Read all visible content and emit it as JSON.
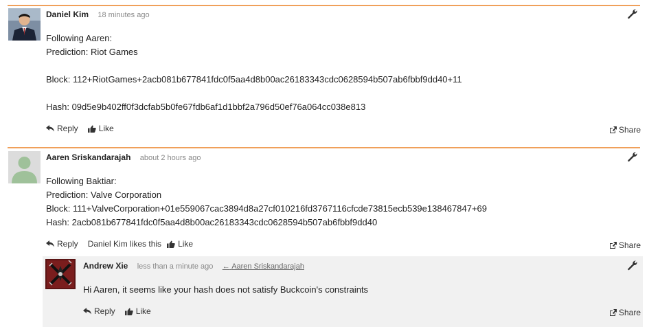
{
  "comments": [
    {
      "author": "Daniel Kim",
      "time": "18 minutes ago",
      "lines": [
        "Following Aaren:",
        "Prediction: Riot Games",
        "",
        "Block: 112+RiotGames+2acb081b677841fdc0f5aa4d8b00ac26183343cdc0628594b507ab6fbbf9dd40+11",
        "",
        "Hash: 09d5e9b402ff0f3dcfab5b0fe67fdb6af1d1bbf2a796d50ef76a064cc038e813"
      ],
      "reply": "Reply",
      "like": "Like",
      "share": "Share"
    },
    {
      "author": "Aaren Sriskandarajah",
      "time": "about 2 hours ago",
      "lines": [
        "Following Baktiar:",
        "Prediction: Valve Corporation",
        "Block: 111+ValveCorporation+01e559067cac3894d8a27cf010216fd3767116cfcde73815ecb539e138467847+69",
        "Hash: 2acb081b677841fdc0f5aa4d8b00ac26183343cdc0628594b507ab6fbbf9dd40"
      ],
      "reply": "Reply",
      "likes_text": "Daniel Kim likes this",
      "like": "Like",
      "share": "Share"
    },
    {
      "author": "Andrew Xie",
      "time": "less than a minute ago",
      "parent_ref": "Aaren Sriskandarajah",
      "lines": [
        "Hi Aaren, it seems like your hash does not satisfy Buckcoin's constraints"
      ],
      "reply": "Reply",
      "like": "Like",
      "share": "Share"
    }
  ]
}
